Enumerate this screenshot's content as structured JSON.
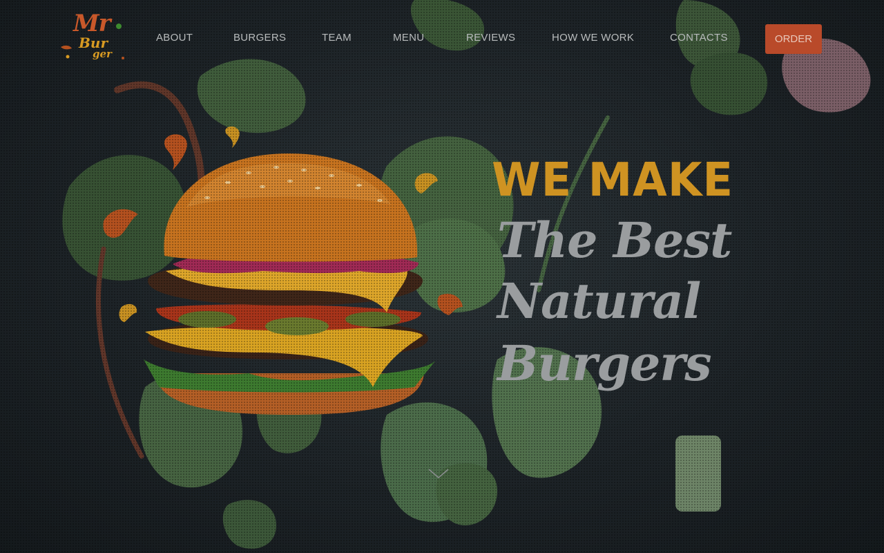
{
  "brand": {
    "logo_line1": "Mr",
    "logo_line2": "Bur",
    "logo_line3": "ger"
  },
  "nav": {
    "items": [
      {
        "label": "ABOUT"
      },
      {
        "label": "BURGERS"
      },
      {
        "label": "TEAM"
      },
      {
        "label": "MENU"
      },
      {
        "label": "REVIEWS"
      },
      {
        "label": "HOW WE WORK"
      },
      {
        "label": "CONTACTS"
      }
    ],
    "order_label": "ORDER"
  },
  "hero": {
    "headline_top": "WE MAKE",
    "headline_line1": "The Best",
    "headline_line2": "Natural",
    "headline_line3": "Burgers"
  },
  "colors": {
    "accent_orange": "#b94a2a",
    "headline_gold": "#cf9322",
    "script_grey": "#9a9d9f",
    "nav_text": "#b9bcbd"
  },
  "icons": {
    "scroll_down": "chevron-down-icon"
  }
}
